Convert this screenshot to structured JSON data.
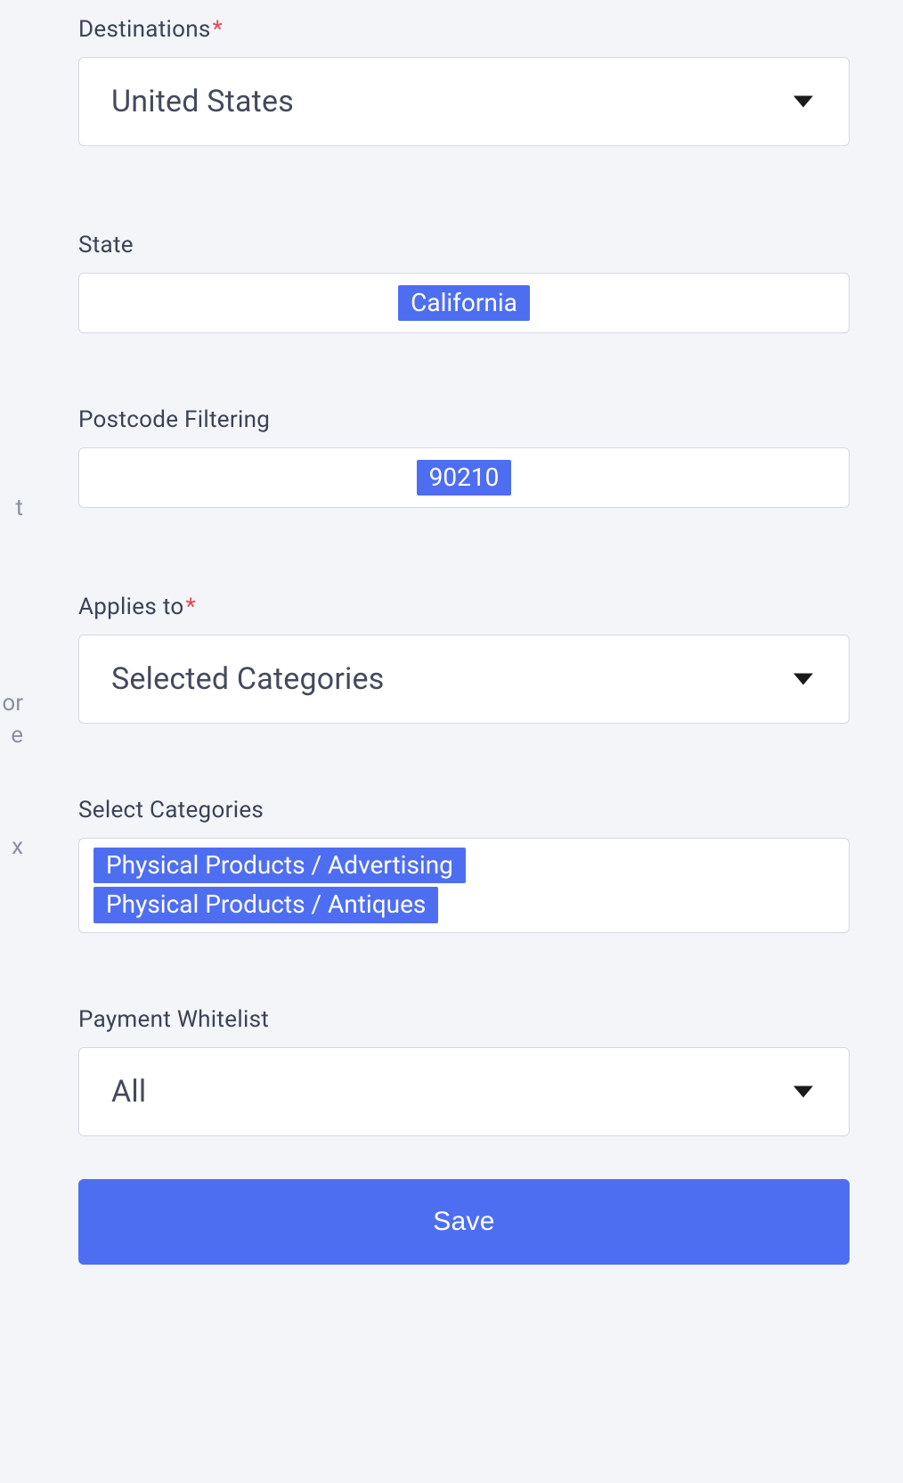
{
  "sidebar": {
    "fragment1": "t",
    "fragment2": "or",
    "fragment3": "e",
    "fragment4": "x"
  },
  "form": {
    "destinations": {
      "label": "Destinations",
      "required": "*",
      "value": "United States"
    },
    "state": {
      "label": "State",
      "tags": [
        "California"
      ]
    },
    "postcode": {
      "label": "Postcode Filtering",
      "tags": [
        "90210"
      ]
    },
    "applies_to": {
      "label": "Applies to",
      "required": "*",
      "value": "Selected Categories"
    },
    "select_categories": {
      "label": "Select Categories",
      "tags": [
        "Physical Products / Advertising",
        "Physical Products / Antiques"
      ]
    },
    "payment_whitelist": {
      "label": "Payment Whitelist",
      "value": "All"
    },
    "save_label": "Save"
  }
}
